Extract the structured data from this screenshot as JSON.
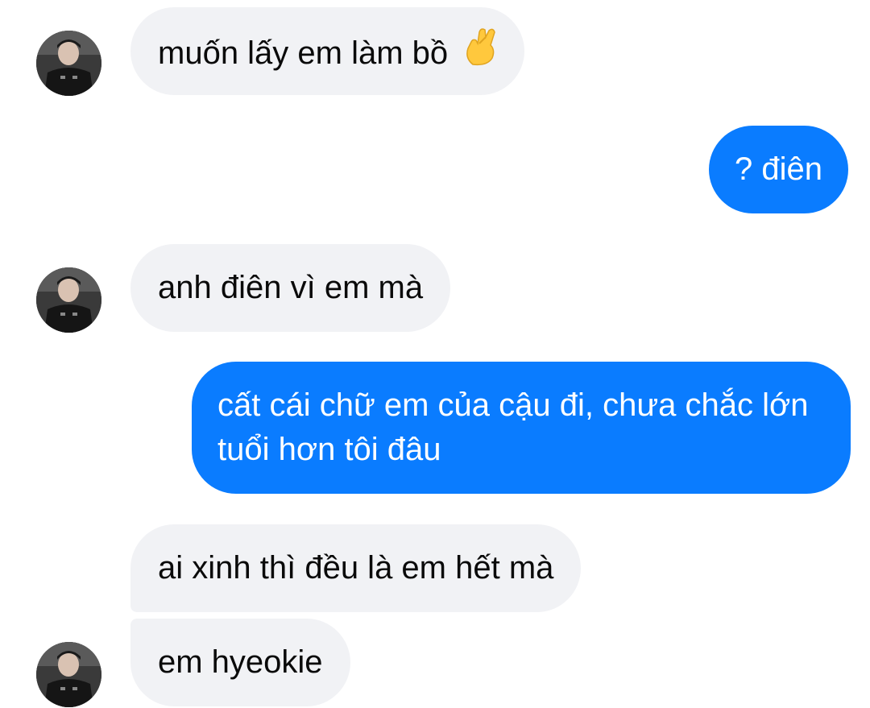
{
  "messages": [
    {
      "side": "incoming",
      "text": "muốn lấy em làm bồ",
      "emoji": "crossed-fingers-heart-icon"
    },
    {
      "side": "outgoing",
      "text": "? điên"
    },
    {
      "side": "incoming",
      "text": "anh điên vì em mà"
    },
    {
      "side": "outgoing",
      "text": "cất cái chữ em của cậu đi, chưa chắc lớn tuổi hơn tôi đâu"
    },
    {
      "side": "incoming",
      "text": "ai xinh thì đều là em hết mà"
    },
    {
      "side": "incoming",
      "text": "em hyeokie"
    }
  ],
  "colors": {
    "incoming_bubble": "#f1f2f5",
    "outgoing_bubble": "#0a7cff",
    "outgoing_text": "#ffffff",
    "background": "#ffffff"
  }
}
